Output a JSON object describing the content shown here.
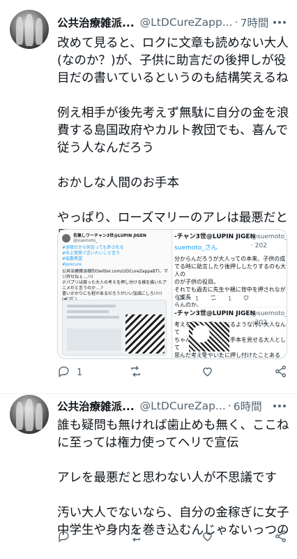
{
  "tweets": [
    {
      "name": "公共治療雑派...",
      "handle": "@LtDCureZapp...",
      "time": "7時間",
      "text": "改めて見ると、ロクに文章も読めない大人(なのか？)が、子供に助言だの後押しが役目だの書いているというのも結構笑えるね\n\n例え相手が後先考えず無駄に自分の金を浪費する島国政府やカルト教団でも、喜んで従う人なんだろう\n\nおかしな人間のお手本\n\nやっぱり、ローズマリーのアレは最悪だと思うよ",
      "reply_count": "1",
      "retweet_count": "",
      "like_count": "",
      "media": {
        "left": {
          "name": "名無しワーチャン3世@LUPIN JIGEN",
          "handle": "@suemoto_",
          "hashtags": "#深夜だから何言っても許される\n#炎上覚悟で言いたいこと言う\n#拡散希望\n#precure",
          "text": "公共治療雑派様的(twitter.com/LtDCureZappaBT)、マジ許せねぇ....!!!\nデパプリは腐った大人の考えを押し付ける様を描いたアニメだと言うのか....?\n書いかかりにも程があるだろうがいい加減にしろ!!!!!\n(#ﾟДﾟ)"
        },
        "right": {
          "post1_name": "-チャン3世@LUPIN JIGEN",
          "post1_handle": "@suemoto_ · 202",
          "post1_mention": "suemoto_さん",
          "post1_text": "分からんだろうが大人っての本来、子供の成\nでる時に助言したり後押ししたりするのも大人の\nのが子供の役目。\nそれでも過去に先生や親に背中を押されながら成長\nらんのか。",
          "post1_reply": "1",
          "post1_rt": "1",
          "post2_name": "-チャン3世@LUPIN JIGEN",
          "post2_handle": "@suemoto_ · 202",
          "post2_text": "考えを子供に押し付けるような汚い大人なんて\nちゃんは子供に悪いお手本を見せる大人として\n思んだ考えをやいたに押し付けたことあるか？\nぞ差別野郎!!!!!ヽ(`Д´#)",
          "post2_like": "2"
        }
      }
    },
    {
      "name": "公共治療雑派...",
      "handle": "@LtDCureZap...",
      "time": "6時間",
      "text": "誰も疑問も無ければ歯止めも無く、ここねに至っては権力使ってヘリで宣伝\n\nアレを最悪だと思わない人が不思議です\n\n汚い大人でないなら、自分の金稼ぎに女子中学生や身内を巻き込むんじゃないっつの",
      "reply_count": "",
      "retweet_count": "",
      "like_count": ""
    }
  ],
  "icons": [
    "more-icon",
    "reply-icon",
    "retweet-icon",
    "like-icon",
    "share-icon"
  ],
  "colors": {
    "text": "#0f1419",
    "secondary": "#536471",
    "link": "#1d9bf0",
    "border": "#eff3f4"
  }
}
